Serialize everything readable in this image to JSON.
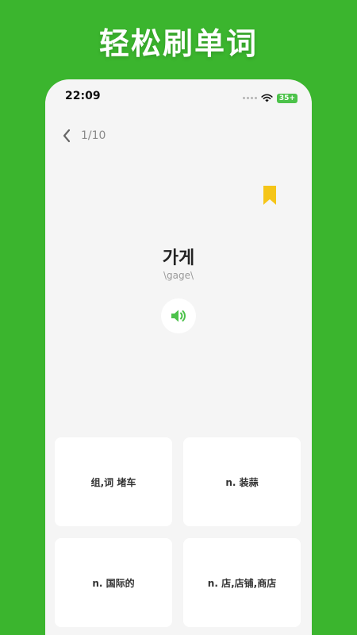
{
  "promo": {
    "title": "轻松刷单词"
  },
  "status_bar": {
    "time": "22:09",
    "battery": "35+"
  },
  "nav": {
    "progress": "1/10"
  },
  "card": {
    "word": "가게",
    "phonetic": "\\gage\\"
  },
  "options": [
    {
      "label": "组,词 堵车"
    },
    {
      "label": "n. 装蒜"
    },
    {
      "label": "n. 国际的"
    },
    {
      "label": "n. 店,店铺,商店"
    }
  ],
  "icons": {
    "back": "chevron-left-icon",
    "bookmark": "bookmark-icon",
    "speaker": "speaker-icon",
    "wifi": "wifi-icon",
    "signal": "signal-icon",
    "battery": "battery-icon"
  },
  "colors": {
    "background": "#3bb52e",
    "accent_green": "#4cc24a",
    "bookmark_yellow": "#f5c518",
    "screen": "#f5f5f5"
  }
}
